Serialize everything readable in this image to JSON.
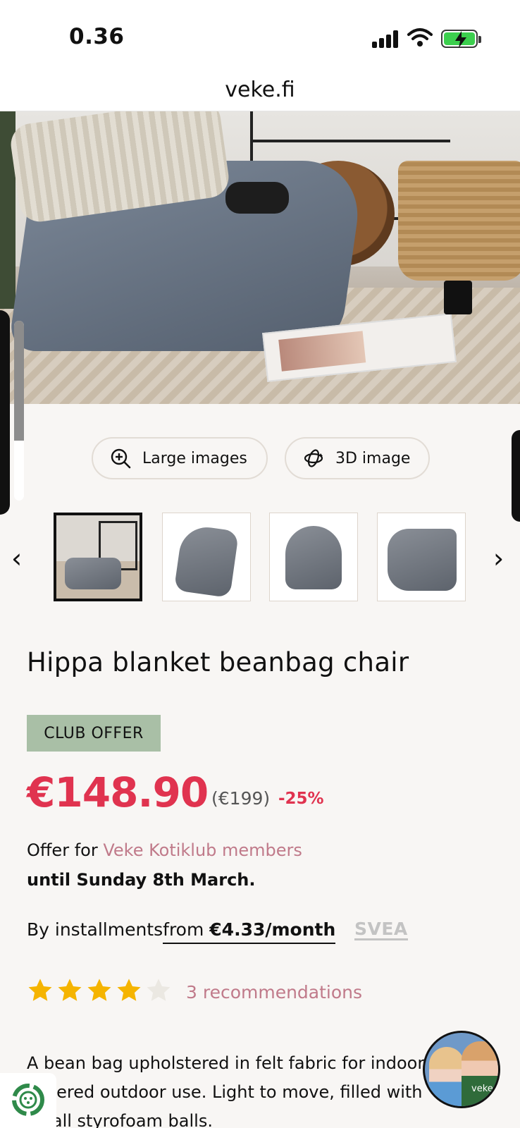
{
  "status_bar": {
    "time": "0.36"
  },
  "browser": {
    "url": "veke.fi"
  },
  "media": {
    "large_images_label": "Large images",
    "three_d_label": "3D image"
  },
  "product": {
    "title": "Hippa blanket beanbag chair",
    "club_badge": "CLUB OFFER",
    "price": "€148.90",
    "old_price": "(€199)",
    "discount": "-25%",
    "offer_prefix": "Offer for ",
    "offer_link": "Veke Kotiklub members",
    "offer_until": "until Sunday 8th March.",
    "installments_prefix": "By installments",
    "installments_from": "from ",
    "installments_amount": "€4.33/month",
    "installments_provider": "SVEA",
    "rating": 4,
    "rating_max": 5,
    "recommendations": "3 recommendations",
    "description": "A bean bag upholstered in felt fabric for indoor or covered outdoor use. Light to move, filled with small styrofoam balls."
  },
  "chat": {
    "avatar_brand": "veke"
  },
  "colors": {
    "accent_red": "#e0334f",
    "link_pink": "#c07a8a",
    "club_green": "#a9bfa6",
    "star_gold": "#f5b400"
  }
}
